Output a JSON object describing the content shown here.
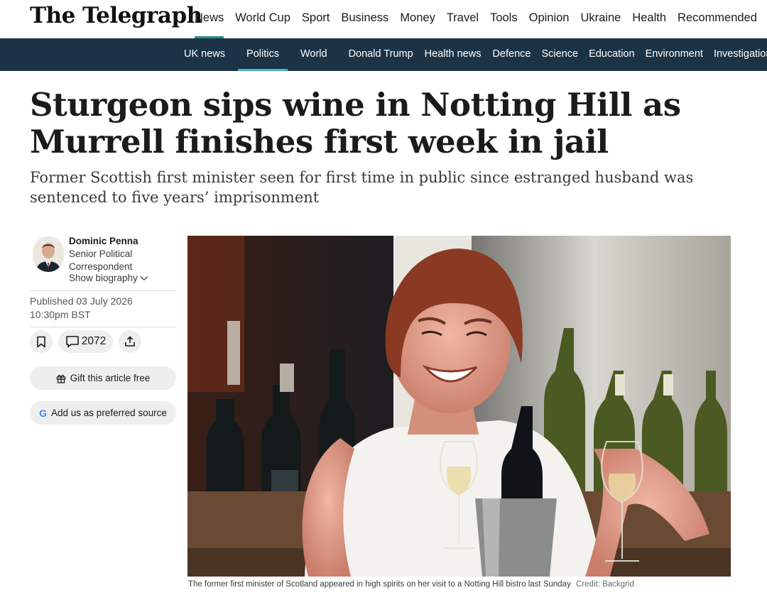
{
  "brand": {
    "logo_text": "The Telegraph"
  },
  "top_nav": [
    "News",
    "World Cup",
    "Sport",
    "Business",
    "Money",
    "Travel",
    "Tools",
    "Opinion",
    "Ukraine",
    "Health",
    "Recommended"
  ],
  "top_nav_active": "News",
  "sub_nav": [
    "UK news",
    "Politics",
    "World",
    "Donald Trump",
    "Health news",
    "Defence",
    "Science",
    "Education",
    "Environment",
    "Investigations"
  ],
  "sub_nav_active": "Politics",
  "article": {
    "headline": "Sturgeon sips wine in Notting Hill as Murrell finishes first week in jail",
    "standfirst": "Former Scottish first minister seen for first time in public since estranged husband was sentenced to five years’ imprisonment"
  },
  "author": {
    "name": "Dominic Penna",
    "role": "Senior Political Correspondent",
    "show_bio_label": "Show biography"
  },
  "published": {
    "line1": "Published 03 July 2026",
    "line2": "10:30pm BST"
  },
  "actions": {
    "comment_count": "2072",
    "gift_label": "Gift this article free",
    "preferred_source_label": "Add us as preferred source"
  },
  "image": {
    "caption": "The former first minister of Scotland appeared in high spirits on her visit to a Notting Hill bistro last Sunday",
    "credit": "Credit: Backgrid"
  },
  "colors": {
    "subnav_bg": "#1c3346",
    "accent_teal": "#2d8a8a"
  }
}
